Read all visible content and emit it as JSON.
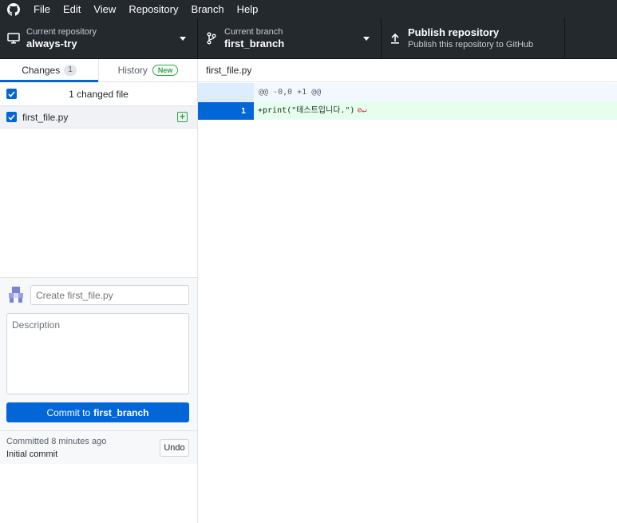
{
  "menu": [
    "File",
    "Edit",
    "View",
    "Repository",
    "Branch",
    "Help"
  ],
  "toolbar": {
    "repo_caption": "Current repository",
    "repo_name": "always-try",
    "branch_caption": "Current branch",
    "branch_name": "first_branch",
    "publish_title": "Publish repository",
    "publish_subtitle": "Publish this repository to GitHub"
  },
  "tabs": {
    "changes_label": "Changes",
    "changes_count": "1",
    "history_label": "History",
    "history_badge": "New"
  },
  "changes": {
    "summary": "1 changed file",
    "files": [
      {
        "name": "first_file.py",
        "status": "added"
      }
    ]
  },
  "commit": {
    "summary_placeholder": "Create first_file.py",
    "description_placeholder": "Description",
    "button_prefix": "Commit to",
    "button_branch": "first_branch"
  },
  "last_commit": {
    "time": "Committed 8 minutes ago",
    "message": "Initial commit",
    "undo_label": "Undo"
  },
  "diff": {
    "file_name": "first_file.py",
    "hunk_header": "@@ -0,0 +1 @@",
    "lines": [
      {
        "number": "1",
        "text": "+print(\"테스트입니다.\")"
      }
    ]
  },
  "colors": {
    "chrome": "#24292e",
    "accent": "#0366d6",
    "added": "#28a745",
    "added_bg": "#e6ffed"
  }
}
